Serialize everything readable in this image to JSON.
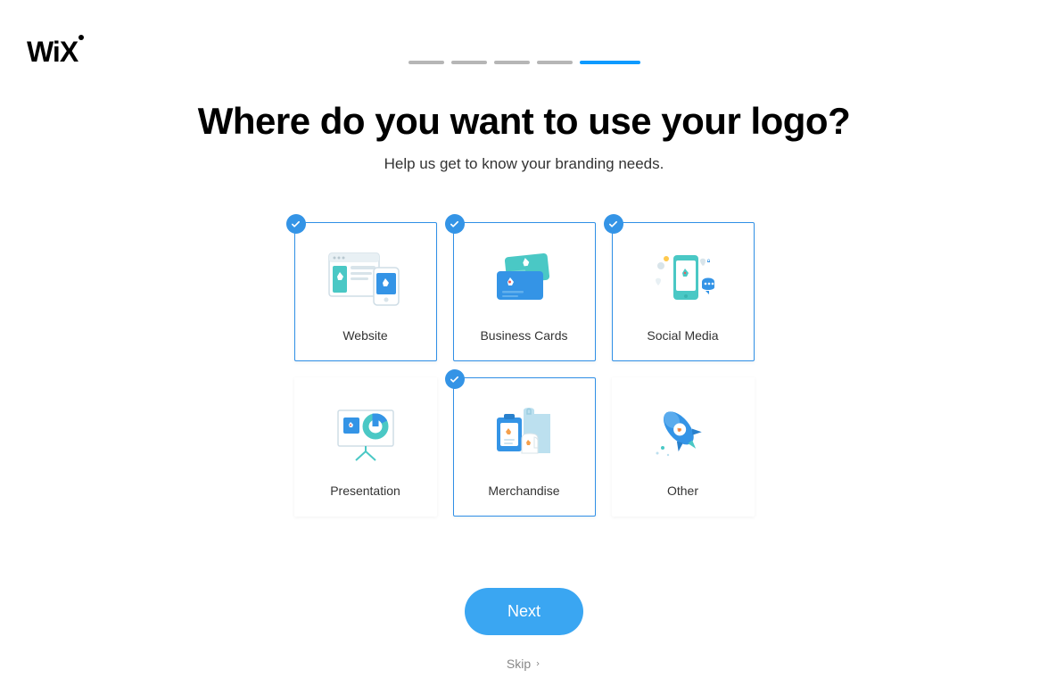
{
  "brand": "WiX",
  "progress": {
    "total": 5,
    "current": 5
  },
  "header": {
    "title": "Where do you want to use your logo?",
    "subtitle": "Help us get to know your branding needs."
  },
  "options": [
    {
      "id": "website",
      "label": "Website",
      "selected": true
    },
    {
      "id": "business-cards",
      "label": "Business Cards",
      "selected": true
    },
    {
      "id": "social-media",
      "label": "Social Media",
      "selected": true
    },
    {
      "id": "presentation",
      "label": "Presentation",
      "selected": false
    },
    {
      "id": "merchandise",
      "label": "Merchandise",
      "selected": true
    },
    {
      "id": "other",
      "label": "Other",
      "selected": false
    }
  ],
  "actions": {
    "next_label": "Next",
    "skip_label": "Skip"
  },
  "colors": {
    "accent": "#0d9aff",
    "button": "#3aa6f2",
    "teal": "#4ac8c5",
    "blue": "#3494e6"
  }
}
